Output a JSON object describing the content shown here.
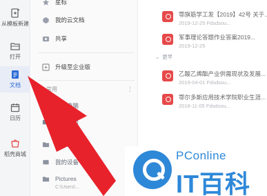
{
  "rail": {
    "items": [
      {
        "label": "从模板新建",
        "icon": "new-from-template-icon"
      },
      {
        "label": "打开",
        "icon": "folder-open-icon"
      },
      {
        "label": "文档",
        "icon": "document-icon"
      },
      {
        "label": "日历",
        "icon": "calendar-icon"
      },
      {
        "label": "稻壳商城",
        "icon": "store-icon"
      }
    ]
  },
  "mid": {
    "top_items": [
      {
        "label": "星标",
        "icon": "star-icon"
      },
      {
        "label": "我的云文档",
        "icon": "cloud-docs-icon"
      },
      {
        "label": "共享",
        "icon": "share-icon"
      }
    ],
    "upgrade": {
      "label": "升级至企业版",
      "icon": "upgrade-icon"
    },
    "section_title": "常用",
    "more": "⋮",
    "common_items": [
      {
        "label": "我的电脑",
        "icon": "computer-icon"
      },
      {
        "label": "我的桌面",
        "icon": "desktop-icon"
      },
      {
        "label": "我的文档",
        "icon": "folder-icon"
      },
      {
        "label": "我的设备",
        "icon": "device-icon"
      },
      {
        "label": "Pictures",
        "sub": "C:\\Users\\...",
        "icon": "folder-icon"
      }
    ]
  },
  "list": {
    "group_label": "更早",
    "items": [
      {
        "title": "鄂旗筋学工发【2019】42号 关于...",
        "meta": "2019-12-25     Fdsdsou..."
      },
      {
        "title": "军事理论答题作业答案2019...",
        "meta": "2019-12-25"
      },
      {
        "title": "乙酸乙烯酯产业供需现状及发展...",
        "meta": "2019-04-01     Fdsdsou..."
      },
      {
        "title": "鄂尔多斯应用技术学院职业生涯...",
        "meta": "2018-11-05     Fdsdsou..."
      }
    ]
  },
  "watermark": {
    "brand": "PConline",
    "sub": "IT百科"
  },
  "colors": {
    "accent": "#2d6bd6",
    "doc_icon": "#e6494a",
    "arrow": "#e8222b",
    "watermark": "#2e88d8"
  }
}
